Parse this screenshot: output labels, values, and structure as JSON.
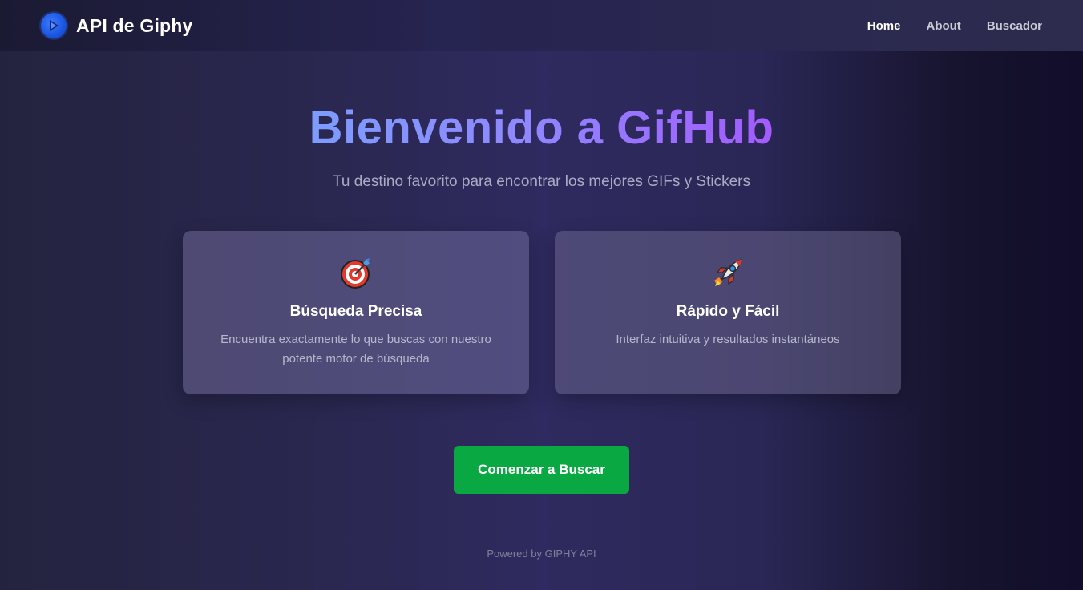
{
  "nav": {
    "brand_title": "API de Giphy",
    "links": [
      {
        "label": "Home",
        "active": true
      },
      {
        "label": "About",
        "active": false
      },
      {
        "label": "Buscador",
        "active": false
      }
    ]
  },
  "hero": {
    "title": "Bienvenido a GifHub",
    "subtitle": "Tu destino favorito para encontrar los mejores GIFs y Stickers"
  },
  "features": [
    {
      "icon": "target-icon",
      "title": "Búsqueda Precisa",
      "description": "Encuentra exactamente lo que buscas con nuestro potente motor de búsqueda"
    },
    {
      "icon": "rocket-icon",
      "title": "Rápido y Fácil",
      "description": "Interfaz intuitiva y resultados instantáneos"
    }
  ],
  "cta": {
    "label": "Comenzar a Buscar"
  },
  "footer": {
    "text": "Powered by GIPHY API"
  },
  "colors": {
    "accent_blue": "#7d9cff",
    "accent_purple": "#a35bff",
    "cta_green": "#0aa842"
  }
}
